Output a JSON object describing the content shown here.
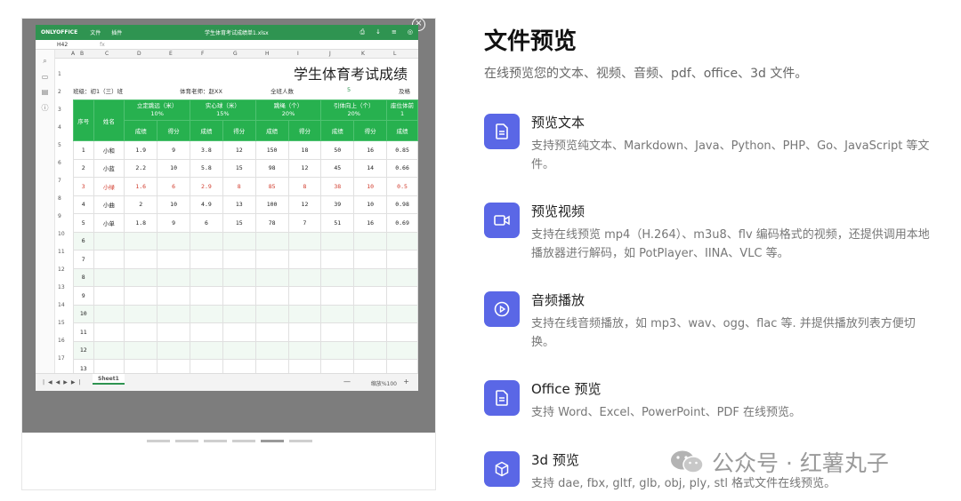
{
  "preview": {
    "close_glyph": "×",
    "spreadsheet": {
      "app_logo": "ONLYOFFICE",
      "menu": [
        "文件",
        "插件"
      ],
      "file_name": "学生体育考试成绩单1.xlsx",
      "cell_ref": "H42",
      "fx": "fx",
      "columns": [
        "A",
        "B",
        "C",
        "D",
        "E",
        "F",
        "G",
        "H",
        "I",
        "J",
        "K",
        "L"
      ],
      "rows": [
        "1",
        "2",
        "3",
        "4",
        "5",
        "6",
        "7",
        "8",
        "9",
        "10",
        "11",
        "12",
        "13",
        "14",
        "15",
        "16",
        "17"
      ],
      "title": "学生体育考试成绩",
      "class_label": "班级：初1（三）班",
      "teacher_label": "体育老师：赵XX",
      "total_label": "全班人数",
      "total_value": "5",
      "pass_label": "及格",
      "header_seq": "序号",
      "header_name": "姓名",
      "groups": [
        {
          "name": "立定跳远（米）",
          "weight": "10%"
        },
        {
          "name": "实心球（米）",
          "weight": "15%"
        },
        {
          "name": "跳绳（个）",
          "weight": "20%"
        },
        {
          "name": "引体向上（个）",
          "weight": "20%"
        },
        {
          "name": "座位体前",
          "weight": "1"
        }
      ],
      "sub_headers": [
        "成绩",
        "得分",
        "成绩",
        "得分",
        "成绩",
        "得分",
        "成绩",
        "得分",
        "成绩"
      ],
      "students": [
        {
          "no": "1",
          "name": "小和",
          "v": [
            "1.9",
            "9",
            "3.8",
            "12",
            "150",
            "18",
            "50",
            "16",
            "0.85"
          ]
        },
        {
          "no": "2",
          "name": "小蓝",
          "v": [
            "2.2",
            "10",
            "5.8",
            "15",
            "98",
            "12",
            "45",
            "14",
            "0.66"
          ]
        },
        {
          "no": "3",
          "name": "小绿",
          "v": [
            "1.6",
            "6",
            "2.9",
            "8",
            "85",
            "8",
            "38",
            "10",
            "0.5"
          ]
        },
        {
          "no": "4",
          "name": "小曲",
          "v": [
            "2",
            "10",
            "4.9",
            "13",
            "100",
            "12",
            "39",
            "10",
            "0.98"
          ]
        },
        {
          "no": "5",
          "name": "小单",
          "v": [
            "1.8",
            "9",
            "6",
            "15",
            "78",
            "7",
            "51",
            "16",
            "0.69"
          ]
        }
      ],
      "empty_rows": [
        "6",
        "7",
        "8",
        "9",
        "10",
        "11",
        "12",
        "13"
      ],
      "sheet_tab": "Sheet1",
      "zoom_label": "缩放%100",
      "zoom_minus": "—",
      "zoom_plus": "+"
    }
  },
  "page": {
    "title": "文件预览",
    "subtitle": "在线预览您的文本、视频、音频、pdf、office、3d 文件。"
  },
  "features": [
    {
      "icon": "document-icon",
      "title": "预览文本",
      "desc": "支持预览纯文本、Markdown、Java、Python、PHP、Go、JavaScript 等文件。"
    },
    {
      "icon": "video-camera-icon",
      "title": "预览视频",
      "desc": "支持在线预览 mp4（H.264）、m3u8、flv 编码格式的视频，还提供调用本地播放器进行解码，如 PotPlayer、IINA、VLC 等。"
    },
    {
      "icon": "play-circle-icon",
      "title": "音频播放",
      "desc": "支持在线音频播放，如 mp3、wav、ogg、flac 等. 并提供播放列表方便切换。"
    },
    {
      "icon": "document-icon",
      "title": "Office 预览",
      "desc": "支持 Word、Excel、PowerPoint、PDF 在线预览。"
    },
    {
      "icon": "cube-icon",
      "title": "3d 预览",
      "desc": "支持 dae, fbx, gltf, glb, obj, ply, stl 格式文件在线预览。"
    }
  ],
  "watermark": {
    "text": "公众号 · 红薯丸子",
    "icon": "wechat-icon"
  },
  "colors": {
    "accent": "#5a67e6",
    "sheet_green": "#27b14f",
    "error_red": "#d13b2c"
  }
}
